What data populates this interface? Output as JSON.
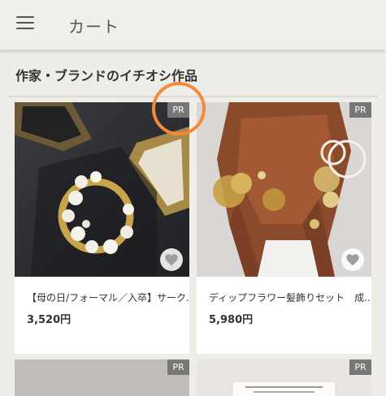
{
  "header": {
    "title": "カート"
  },
  "section": {
    "title": "作家・ブランドのイチオシ作品"
  },
  "products": [
    {
      "badge": "PR",
      "name": "【母の日/フォーマル／入卒】サーク...",
      "price": "3,520円"
    },
    {
      "badge": "PR",
      "name": "ディップフラワー髪飾りセット　成...",
      "price": "5,980円"
    },
    {
      "badge": "PR"
    },
    {
      "badge": "PR"
    }
  ],
  "colors": {
    "highlight_ring": "#f28a38",
    "badge_bg": "#777777"
  },
  "icons": {
    "menu": "hamburger-menu-icon",
    "favorite": "heart-icon"
  }
}
